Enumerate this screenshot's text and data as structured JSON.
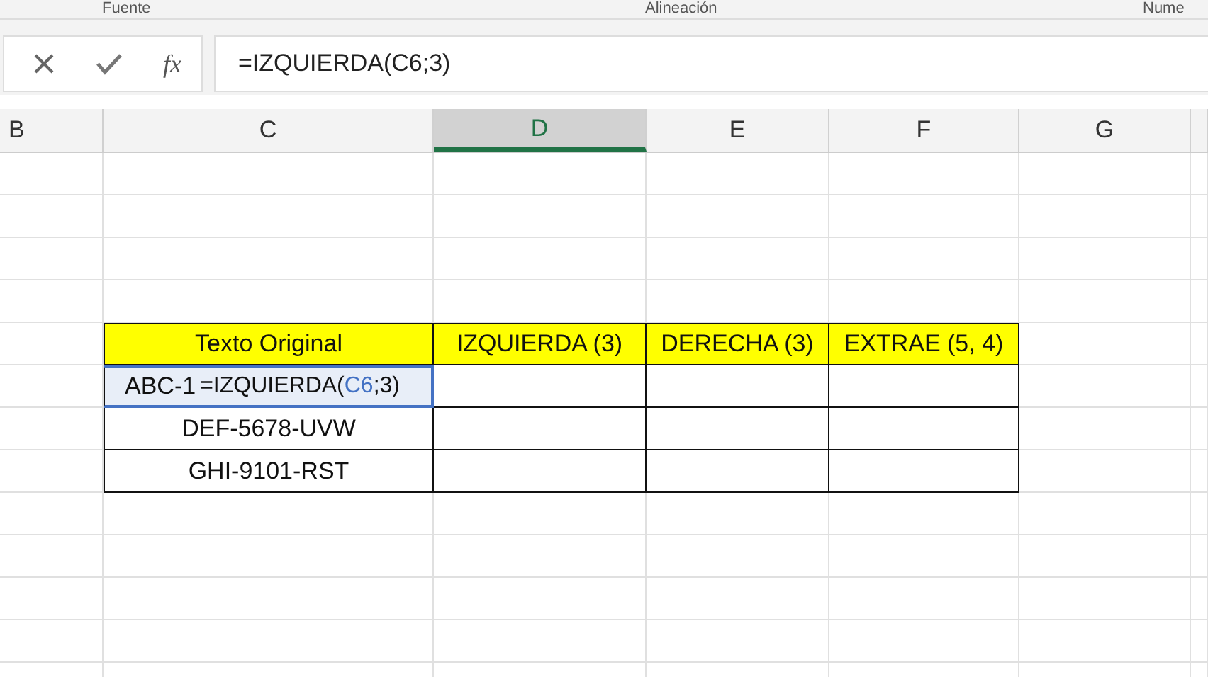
{
  "ribbon_groups": [
    "Fuente",
    "Alineación",
    "Nume"
  ],
  "formula_bar": {
    "function_label": "fx",
    "formula": "=IZQUIERDA(C6;3)"
  },
  "columns": [
    {
      "label": "B",
      "selected": false
    },
    {
      "label": "C",
      "selected": false
    },
    {
      "label": "D",
      "selected": true
    },
    {
      "label": "E",
      "selected": false
    },
    {
      "label": "F",
      "selected": false
    },
    {
      "label": "G",
      "selected": false
    }
  ],
  "table": {
    "headers": [
      "Texto Original",
      "IZQUIERDA (3)",
      "DERECHA (3)",
      "EXTRAE (5, 4)"
    ],
    "rows": [
      [
        "ABC-1",
        "",
        "",
        ""
      ],
      [
        "DEF-5678-UVW",
        "",
        "",
        ""
      ],
      [
        "GHI-9101-RST",
        "",
        "",
        ""
      ]
    ]
  },
  "editor": {
    "before": "=IZQUIERDA(",
    "reference": "C6",
    "after": ";3)"
  }
}
